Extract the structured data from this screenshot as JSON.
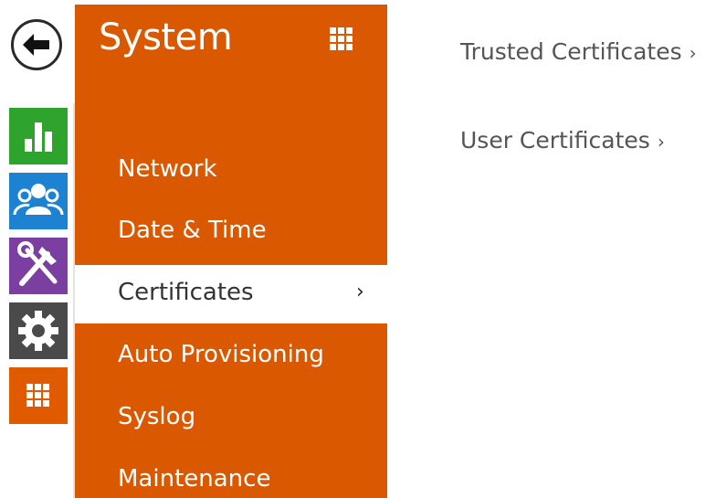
{
  "rail": {
    "items": [
      {
        "name": "status",
        "icon": "bar-chart-icon",
        "color": "#2ea32e"
      },
      {
        "name": "directory",
        "icon": "users-icon",
        "color": "#1e82d2"
      },
      {
        "name": "hardware",
        "icon": "tools-icon",
        "color": "#7a3fa0"
      },
      {
        "name": "services",
        "icon": "gear-icon",
        "color": "#4a4a4a"
      },
      {
        "name": "system",
        "icon": "grid-icon",
        "color": "#e05a00"
      }
    ],
    "back_icon": "back-arrow-icon"
  },
  "panel": {
    "title": "System",
    "color": "#d95800",
    "grid_icon": "grid-icon",
    "menu": [
      {
        "label": "Network",
        "active": false
      },
      {
        "label": "Date & Time",
        "active": false
      },
      {
        "label": "Certificates",
        "active": true,
        "chevron": "›"
      },
      {
        "label": "Auto Provisioning",
        "active": false
      },
      {
        "label": "Syslog",
        "active": false
      },
      {
        "label": "Maintenance",
        "active": false
      }
    ]
  },
  "content": {
    "links": [
      {
        "label": "Trusted Certificates",
        "chevron": "›"
      },
      {
        "label": "User Certificates",
        "chevron": "›"
      }
    ]
  }
}
